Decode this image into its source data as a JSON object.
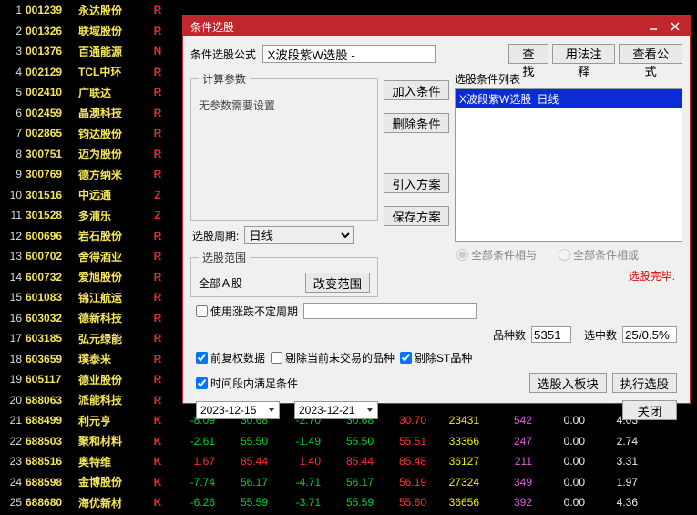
{
  "rows": [
    {
      "i": 1,
      "code": "001239",
      "name": "永达股份",
      "flag": "R"
    },
    {
      "i": 2,
      "code": "001326",
      "name": "联域股份",
      "flag": "R"
    },
    {
      "i": 3,
      "code": "001376",
      "name": "百通能源",
      "flag": "N"
    },
    {
      "i": 4,
      "code": "002129",
      "name": "TCL中环",
      "flag": "R"
    },
    {
      "i": 5,
      "code": "002410",
      "name": "广联达",
      "flag": "R"
    },
    {
      "i": 6,
      "code": "002459",
      "name": "晶澳科技",
      "flag": "R"
    },
    {
      "i": 7,
      "code": "002865",
      "name": "钧达股份",
      "flag": "R"
    },
    {
      "i": 8,
      "code": "300751",
      "name": "迈为股份",
      "flag": "R"
    },
    {
      "i": 9,
      "code": "300769",
      "name": "德方纳米",
      "flag": "R"
    },
    {
      "i": 10,
      "code": "301516",
      "name": "中远通",
      "flag": "Z"
    },
    {
      "i": 11,
      "code": "301528",
      "name": "多浦乐",
      "flag": "Z"
    },
    {
      "i": 12,
      "code": "600696",
      "name": "岩石股份",
      "flag": "R"
    },
    {
      "i": 13,
      "code": "600702",
      "name": "舍得酒业",
      "flag": "R"
    },
    {
      "i": 14,
      "code": "600732",
      "name": "爱旭股份",
      "flag": "R"
    },
    {
      "i": 15,
      "code": "601083",
      "name": "锦江航运",
      "flag": "R"
    },
    {
      "i": 16,
      "code": "603032",
      "name": "德新科技",
      "flag": "R"
    },
    {
      "i": 17,
      "code": "603185",
      "name": "弘元绿能",
      "flag": "R"
    },
    {
      "i": 18,
      "code": "603659",
      "name": "璞泰来",
      "flag": "R"
    },
    {
      "i": 19,
      "code": "605117",
      "name": "德业股份",
      "flag": "R"
    },
    {
      "i": 20,
      "code": "688063",
      "name": "派能科技",
      "flag": "R"
    },
    {
      "i": 21,
      "code": "688499",
      "name": "利元亨",
      "flag": "K",
      "v": [
        "-8.09",
        "30.68",
        "-2.70",
        "30.68",
        "30.70",
        "23431",
        "542",
        "0.00",
        "4.03"
      ]
    },
    {
      "i": 22,
      "code": "688503",
      "name": "聚和材料",
      "flag": "K",
      "v": [
        "-2.61",
        "55.50",
        "-1.49",
        "55.50",
        "55.51",
        "33366",
        "247",
        "0.00",
        "2.74"
      ]
    },
    {
      "i": 23,
      "code": "688516",
      "name": "奥特维",
      "flag": "K",
      "v": [
        "1.67",
        "85.44",
        "1.40",
        "85.44",
        "85.48",
        "36127",
        "211",
        "0.00",
        "3.31"
      ]
    },
    {
      "i": 24,
      "code": "688598",
      "name": "金博股份",
      "flag": "K",
      "v": [
        "-7.74",
        "56.17",
        "-4.71",
        "56.17",
        "56.19",
        "27324",
        "349",
        "0.00",
        "1.97"
      ]
    },
    {
      "i": 25,
      "code": "688680",
      "name": "海优新材",
      "flag": "K",
      "v": [
        "-6.26",
        "55.59",
        "-3.71",
        "55.59",
        "55.60",
        "36656",
        "392",
        "0.00",
        "4.36"
      ]
    }
  ],
  "dlg": {
    "title": "条件选股",
    "formula_label": "条件选股公式",
    "formula_value": "X波段紫W选股 -",
    "search": "查找",
    "usage": "用法注释",
    "view": "查看公式",
    "calc": "计算参数",
    "noparam": "无参数需要设置",
    "add": "加入条件",
    "del": "删除条件",
    "import": "引入方案",
    "save": "保存方案",
    "listhdr": "选股条件列表",
    "listitem": "X波段紫W选股",
    "listsub": "日线",
    "period_label": "选股周期:",
    "period": "日线",
    "scope_label": "选股范围",
    "scope": "全部Ａ股",
    "change": "改变范围",
    "radio_and": "全部条件相与",
    "radio_or": "全部条件相或",
    "status": "选股完毕.",
    "usecycle": "使用涨跌不定周期",
    "varieties_label": "品种数",
    "varieties": "5351",
    "hits_label": "选中数",
    "hits": "25/0.5%",
    "chk1": "前复权数据",
    "chk2": "剔除当前未交易的品种",
    "chk3": "剔除ST品种",
    "chk4": "时间段内满足条件",
    "toplate": "选股入板块",
    "run": "执行选股",
    "date1": "2023-12-15",
    "date2": "2023-12-21",
    "sep": "-",
    "close": "关闭"
  }
}
